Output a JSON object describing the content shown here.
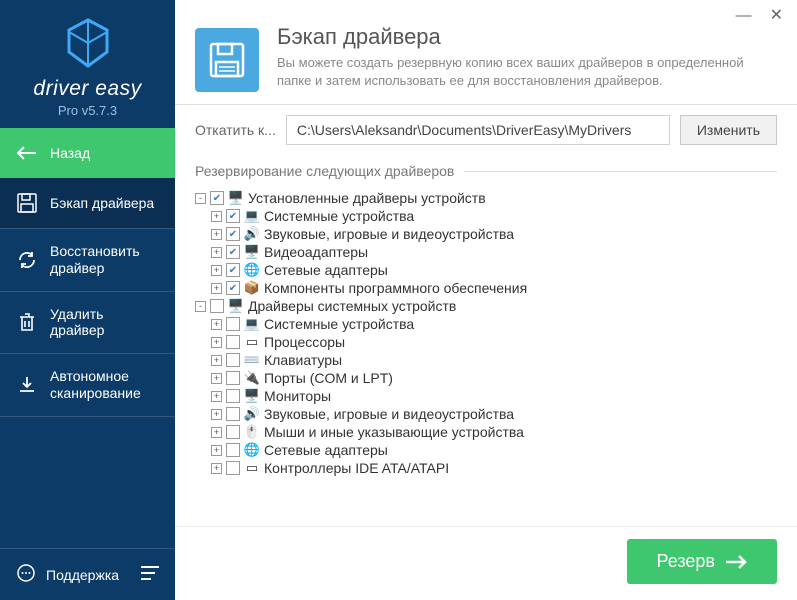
{
  "brand": {
    "name": "driver easy",
    "version": "Pro v5.7.3"
  },
  "sidebar": {
    "back": "Назад",
    "items": [
      {
        "label": "Бэкап драйвера"
      },
      {
        "label": "Восстановить драйвер"
      },
      {
        "label": "Удалить драйвер"
      },
      {
        "label": "Автономное сканирование"
      }
    ],
    "support": "Поддержка"
  },
  "header": {
    "title": "Бэкап драйвера",
    "desc": "Вы можете создать резервную копию всех ваших драйверов в определенной папке и затем использовать ее для восстановления драйверов."
  },
  "path": {
    "label": "Откатить к...",
    "value": "C:\\Users\\Aleksandr\\Documents\\DriverEasy\\MyDrivers",
    "button": "Изменить"
  },
  "group_label": "Резервирование следующих драйверов",
  "tree": [
    {
      "level": 0,
      "expander": "-",
      "checked": true,
      "icon": "🖥️",
      "label": "Установленные драйверы устройств"
    },
    {
      "level": 1,
      "expander": "+",
      "checked": true,
      "icon": "💻",
      "label": "Системные устройства"
    },
    {
      "level": 1,
      "expander": "+",
      "checked": true,
      "icon": "🔊",
      "label": "Звуковые, игровые и видеоустройства"
    },
    {
      "level": 1,
      "expander": "+",
      "checked": true,
      "icon": "🖥️",
      "label": "Видеоадаптеры"
    },
    {
      "level": 1,
      "expander": "+",
      "checked": true,
      "icon": "🌐",
      "label": "Сетевые адаптеры"
    },
    {
      "level": 1,
      "expander": "+",
      "checked": true,
      "icon": "📦",
      "label": "Компоненты программного обеспечения"
    },
    {
      "level": 0,
      "expander": "-",
      "checked": false,
      "icon": "🖥️",
      "label": "Драйверы системных устройств"
    },
    {
      "level": 1,
      "expander": "+",
      "checked": false,
      "icon": "💻",
      "label": "Системные устройства"
    },
    {
      "level": 1,
      "expander": "+",
      "checked": false,
      "icon": "▭",
      "label": "Процессоры"
    },
    {
      "level": 1,
      "expander": "+",
      "checked": false,
      "icon": "⌨️",
      "label": "Клавиатуры"
    },
    {
      "level": 1,
      "expander": "+",
      "checked": false,
      "icon": "🔌",
      "label": "Порты (COM и LPT)"
    },
    {
      "level": 1,
      "expander": "+",
      "checked": false,
      "icon": "🖥️",
      "label": "Мониторы"
    },
    {
      "level": 1,
      "expander": "+",
      "checked": false,
      "icon": "🔊",
      "label": "Звуковые, игровые и видеоустройства"
    },
    {
      "level": 1,
      "expander": "+",
      "checked": false,
      "icon": "🖱️",
      "label": "Мыши и иные указывающие устройства"
    },
    {
      "level": 1,
      "expander": "+",
      "checked": false,
      "icon": "🌐",
      "label": "Сетевые адаптеры"
    },
    {
      "level": 1,
      "expander": "+",
      "checked": false,
      "icon": "▭",
      "label": "Контроллеры IDE ATA/ATAPI"
    }
  ],
  "action_button": "Резерв"
}
